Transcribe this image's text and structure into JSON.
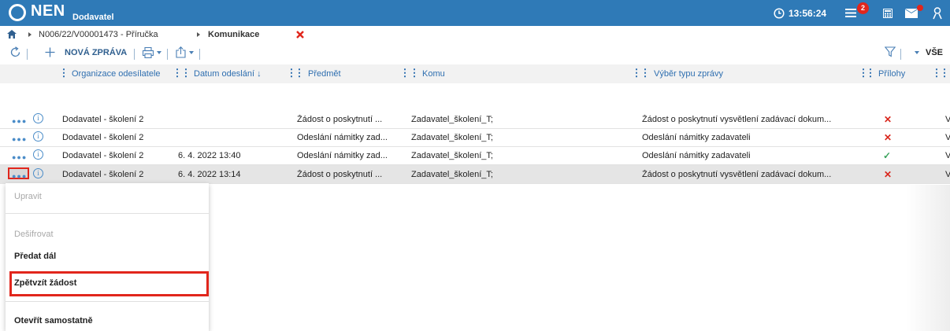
{
  "header": {
    "logo": "NEN",
    "role": "Dodavatel",
    "time": "13:56:24",
    "notifications_count": "2",
    "accent_color": "#2f7ab7",
    "icons": [
      "clock-icon",
      "notifications-icon",
      "calculator-icon",
      "mail-icon",
      "user-icon"
    ]
  },
  "breadcrumb": {
    "items": [
      "N006/22/V00001473 - Příručka",
      "Komunikace"
    ],
    "close_icon": "close-icon"
  },
  "toolbar": {
    "new_message": "NOVÁ ZPRÁVA",
    "filter_label": "VŠE",
    "icons": [
      "refresh-icon",
      "plus-icon",
      "print-icon",
      "export-icon",
      "filter-icon"
    ]
  },
  "table": {
    "columns": [
      "Organizace odesílatele",
      "Datum odeslání ↓",
      "Předmět",
      "Komu",
      "Výběr typu zprávy",
      "Přílohy"
    ],
    "rows": [
      {
        "org": "Dodavatel - školení 2",
        "date": "",
        "subject": "Žádost o poskytnutí ...",
        "to": "Zadavatel_školení_T;",
        "type": "Žádost o poskytnutí vysvětlení zadávací dokum...",
        "attach": "x",
        "extra": "V"
      },
      {
        "org": "Dodavatel - školení 2",
        "date": "",
        "subject": "Odeslání námitky zad...",
        "to": "Zadavatel_školení_T;",
        "type": "Odeslání námitky zadavateli",
        "attach": "x",
        "extra": "V"
      },
      {
        "org": "Dodavatel - školení 2",
        "date": "6. 4. 2022 13:40",
        "subject": "Odeslání námitky zad...",
        "to": "Zadavatel_školení_T;",
        "type": "Odeslání námitky zadavateli",
        "attach": "check",
        "extra": "V"
      },
      {
        "org": "Dodavatel - školení 2",
        "date": "6. 4. 2022 13:14",
        "subject": "Žádost o poskytnutí ...",
        "to": "Zadavatel_školení_T;",
        "type": "Žádost o poskytnutí vysvětlení zadávací dokum...",
        "attach": "x",
        "extra": "V"
      }
    ]
  },
  "context_menu": {
    "items": [
      "Upravit",
      "Dešifrovat",
      "Předat dál",
      "Zpětvzít žádost",
      "Otevřít samostatně"
    ],
    "highlight_color": "#e1261c"
  }
}
